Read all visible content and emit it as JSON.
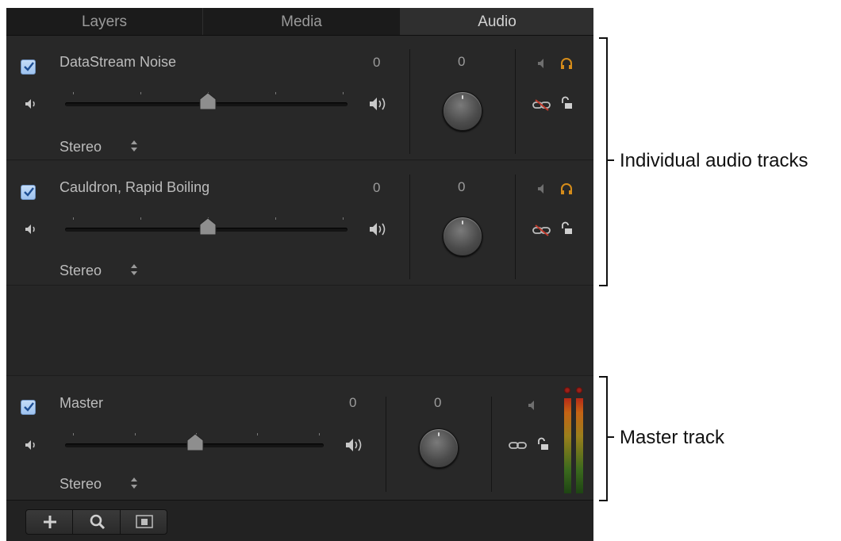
{
  "tabs": [
    "Layers",
    "Media",
    "Audio"
  ],
  "tracks": [
    {
      "name": "DataStream Noise",
      "level": "0",
      "pan": "0",
      "output": "Stereo"
    },
    {
      "name": "Cauldron, Rapid Boiling",
      "level": "0",
      "pan": "0",
      "output": "Stereo"
    }
  ],
  "master": {
    "name": "Master",
    "level": "0",
    "pan": "0",
    "output": "Stereo"
  },
  "annotations": {
    "individual": "Individual audio tracks",
    "master": "Master track"
  },
  "colors": {
    "check": "#9ec3ef",
    "solo": "#d58c1a",
    "unlink": "#c0392b"
  }
}
